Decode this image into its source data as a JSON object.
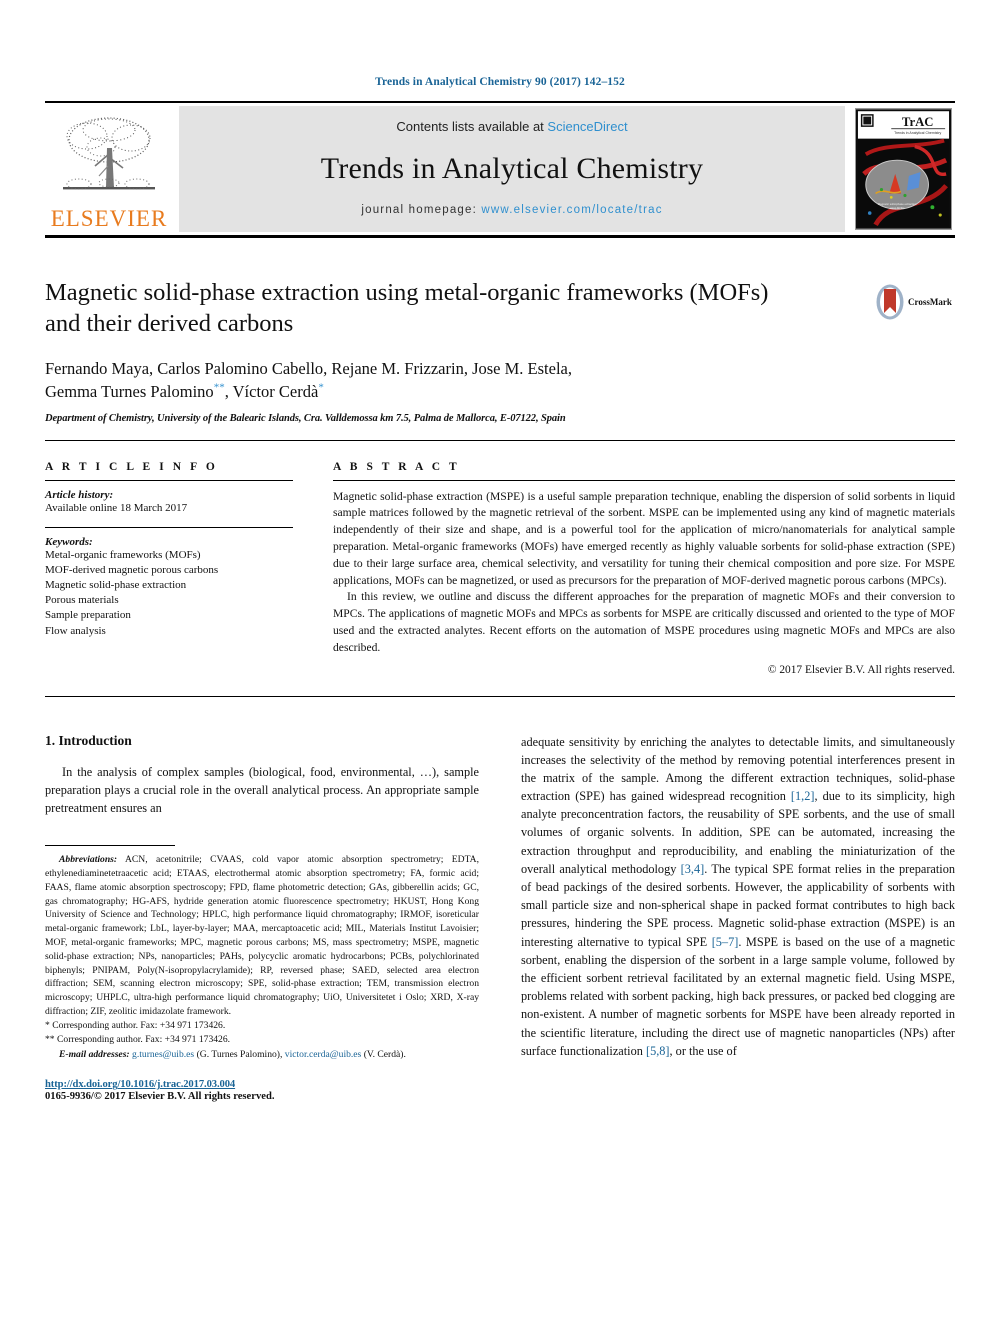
{
  "running_head": "Trends in Analytical Chemistry 90 (2017) 142–152",
  "masthead": {
    "publisher": "ELSEVIER",
    "contents_prefix": "Contents lists available at ",
    "contents_link": "ScienceDirect",
    "journal_title": "Trends in Analytical Chemistry",
    "homepage_prefix": "journal homepage: ",
    "homepage_url": "www.elsevier.com/locate/trac",
    "cover_title": "TrAC",
    "cover_subtitle": "Trends in Analytical Chemistry"
  },
  "article": {
    "title": "Magnetic solid-phase extraction using metal-organic frameworks (MOFs) and their derived carbons",
    "crossmark_label": "CrossMark",
    "authors_line_1": "Fernando Maya, Carlos Palomino Cabello, Rejane M. Frizzarin, Jose M. Estela,",
    "authors_line_2_a": "Gemma Turnes Palomino",
    "authors_line_2_mark_a": "**",
    "authors_line_2_b": ", Víctor Cerdà",
    "authors_line_2_mark_b": "*",
    "affiliation": "Department of Chemistry, University of the Balearic Islands, Cra. Valldemossa km 7.5, Palma de Mallorca, E-07122, Spain"
  },
  "article_info": {
    "heading": "A R T I C L E   I N F O",
    "history_label": "Article history:",
    "history_value": "Available online 18 March 2017",
    "keywords_label": "Keywords:",
    "keywords": [
      "Metal-organic frameworks (MOFs)",
      "MOF-derived magnetic porous carbons",
      "Magnetic solid-phase extraction",
      "Porous materials",
      "Sample preparation",
      "Flow analysis"
    ]
  },
  "abstract": {
    "heading": "A B S T R A C T",
    "paragraph_1": "Magnetic solid-phase extraction (MSPE) is a useful sample preparation technique, enabling the dispersion of solid sorbents in liquid sample matrices followed by the magnetic retrieval of the sorbent. MSPE can be implemented using any kind of magnetic materials independently of their size and shape, and is a powerful tool for the application of micro/nanomaterials for analytical sample preparation. Metal-organic frameworks (MOFs) have emerged recently as highly valuable sorbents for solid-phase extraction (SPE) due to their large surface area, chemical selectivity, and versatility for tuning their chemical composition and pore size. For MSPE applications, MOFs can be magnetized, or used as precursors for the preparation of MOF-derived magnetic porous carbons (MPCs).",
    "paragraph_2": "In this review, we outline and discuss the different approaches for the preparation of magnetic MOFs and their conversion to MPCs. The applications of magnetic MOFs and MPCs as sorbents for MSPE are critically discussed and oriented to the type of MOF used and the extracted analytes. Recent efforts on the automation of MSPE procedures using magnetic MOFs and MPCs are also described.",
    "copyright": "© 2017 Elsevier B.V. All rights reserved."
  },
  "body": {
    "section_title": "1.  Introduction",
    "left_paragraph": "In the analysis of complex samples (biological, food, environmental, …), sample preparation plays a crucial role in the overall analytical process. An appropriate sample pretreatment ensures an",
    "right_part_1": "adequate sensitivity by enriching the analytes to detectable limits, and simultaneously increases the selectivity of the method by removing potential interferences present in the matrix of the sample. Among the different extraction techniques, solid-phase extraction (SPE) has gained widespread recognition ",
    "right_ref_1": "[1,2]",
    "right_part_2": ", due to its simplicity, high analyte preconcentration factors, the reusability of SPE sorbents, and the use of small volumes of organic solvents. In addition, SPE can be automated, increasing the extraction throughput and reproducibility, and enabling the miniaturization of the overall analytical methodology ",
    "right_ref_2": "[3,4]",
    "right_part_3": ". The typical SPE format relies in the preparation of bead packings of the desired sorbents. However, the applicability of sorbents with small particle size and non-spherical shape in packed format contributes to high back pressures, hindering the SPE process. Magnetic solid-phase extraction (MSPE) is an interesting alternative to typical SPE ",
    "right_ref_3": "[5–7]",
    "right_part_4": ". MSPE is based on the use of a magnetic sorbent, enabling the dispersion of the sorbent in a large sample volume, followed by the efficient sorbent retrieval facilitated by an external magnetic field. Using MSPE, problems related with sorbent packing, high back pressures, or packed bed clogging are non-existent. A number of magnetic sorbents for MSPE have been already reported in the scientific literature, including the direct use of magnetic nanoparticles (NPs) after surface functionalization ",
    "right_ref_4": "[5,8]",
    "right_part_5": ", or the use of"
  },
  "footnotes": {
    "abbreviations_label": "Abbreviations:",
    "abbreviations_text": " ACN, acetonitrile; CVAAS, cold vapor atomic absorption spectrometry; EDTA, ethylenediaminetetraacetic acid; ETAAS, electrothermal atomic absorption spectrometry; FA, formic acid; FAAS, flame atomic absorption spectroscopy; FPD, flame photometric detection; GAs, gibberellin acids; GC, gas chromatography; HG-AFS, hydride generation atomic fluorescence spectrometry; HKUST, Hong Kong University of Science and Technology; HPLC, high performance liquid chromatography; IRMOF, isoreticular metal-organic framework; LbL, layer-by-layer; MAA, mercaptoacetic acid; MIL, Materials Institut Lavoisier; MOF, metal-organic frameworks; MPC, magnetic porous carbons; MS, mass spectrometry; MSPE, magnetic solid-phase extraction; NPs, nanoparticles; PAHs, polycyclic aromatic hydrocarbons; PCBs, polychlorinated biphenyls; PNIPAM, Poly(N-isopropylacrylamide); RP, reversed phase; SAED, selected area electron diffraction; SEM, scanning electron microscopy; SPE, solid-phase extraction; TEM, transmission electron microscopy; UHPLC, ultra-high performance liquid chromatography; UiO, Universitetet i Oslo; XRD, X-ray diffraction; ZIF, zeolitic imidazolate framework.",
    "corresponding_1_mark": "*",
    "corresponding_1": "Corresponding author. Fax: +34 971 173426.",
    "corresponding_2_mark": "**",
    "corresponding_2": "Corresponding author. Fax: +34 971 173426.",
    "email_label": "E-mail addresses:",
    "email_1": "g.turnes@uib.es",
    "email_1_owner": " (G. Turnes Palomino), ",
    "email_2": "victor.cerda@uib.es",
    "email_2_owner": " (V. Cerdà).",
    "doi": "http://dx.doi.org/10.1016/j.trac.2017.03.004",
    "issn": "0165-9936/© 2017 Elsevier B.V. All rights reserved."
  },
  "colors": {
    "link_blue": "#1a6496",
    "science_direct_blue": "#2f8fce",
    "elsevier_orange": "#e87b1e",
    "masthead_grey": "#e3e3e3"
  }
}
